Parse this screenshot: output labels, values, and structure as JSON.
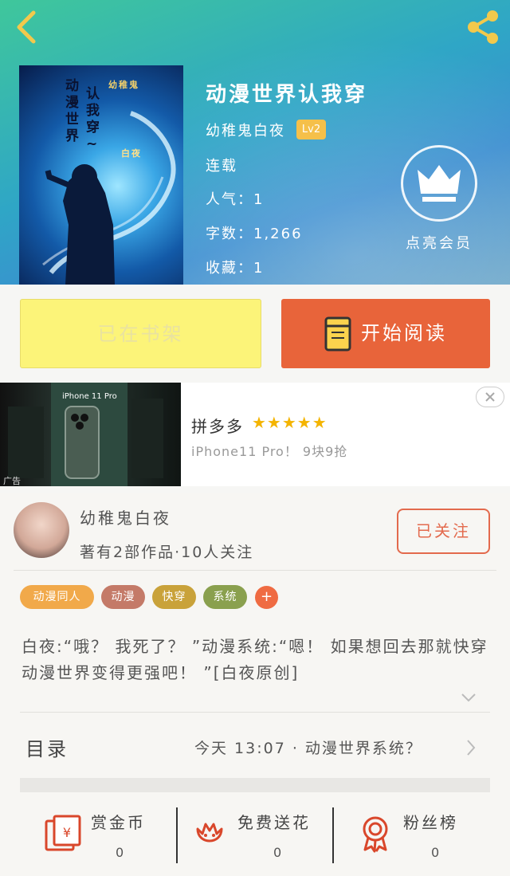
{
  "book": {
    "title": "动漫世界认我穿",
    "author": "幼稚鬼白夜",
    "level": "Lv2",
    "status": "连载",
    "popularity": "人气：1",
    "word_count": "字数：1,266",
    "favorites": "收藏：1",
    "vip_label": "点亮会员"
  },
  "cover": {
    "col1": "动漫世界",
    "col2": "认我穿~",
    "col3": "幼稚鬼",
    "col4": "白夜"
  },
  "actions": {
    "on_shelf": "已在书架",
    "start_reading": "开始阅读"
  },
  "ad": {
    "image_label": "iPhone 11 Pro",
    "tag": "广告",
    "brand": "拼多多",
    "stars": "★★★★★",
    "rating": 5,
    "description": "iPhone11 Pro！ 9块9抢"
  },
  "author_card": {
    "name": "幼稚鬼白夜",
    "subtitle": "著有2部作品·10人关注",
    "follow_label": "已关注"
  },
  "tags": [
    "动漫同人",
    "动漫",
    "快穿",
    "系统"
  ],
  "tag_add": "+",
  "description": "白夜:“哦？ 我死了？ ”动漫系统:“嗯！ 如果想回去那就快穿动漫世界变得更强吧！ ”[白夜原创]",
  "toc": {
    "label": "目录",
    "latest": "今天 13:07 · 动漫世界系统？"
  },
  "bottom": {
    "reward_label": "赏金币",
    "reward_count": "0",
    "flower_label": "免费送花",
    "flower_count": "0",
    "fans_label": "粉丝榜",
    "fans_count": "0"
  },
  "colors": {
    "accent_orange": "#e8643a",
    "shelf_yellow": "#fcf479",
    "tag_1": "#f1a94a",
    "tag_2": "#c47a68",
    "tag_3": "#c9a23a",
    "tag_4": "#8aa04e"
  }
}
